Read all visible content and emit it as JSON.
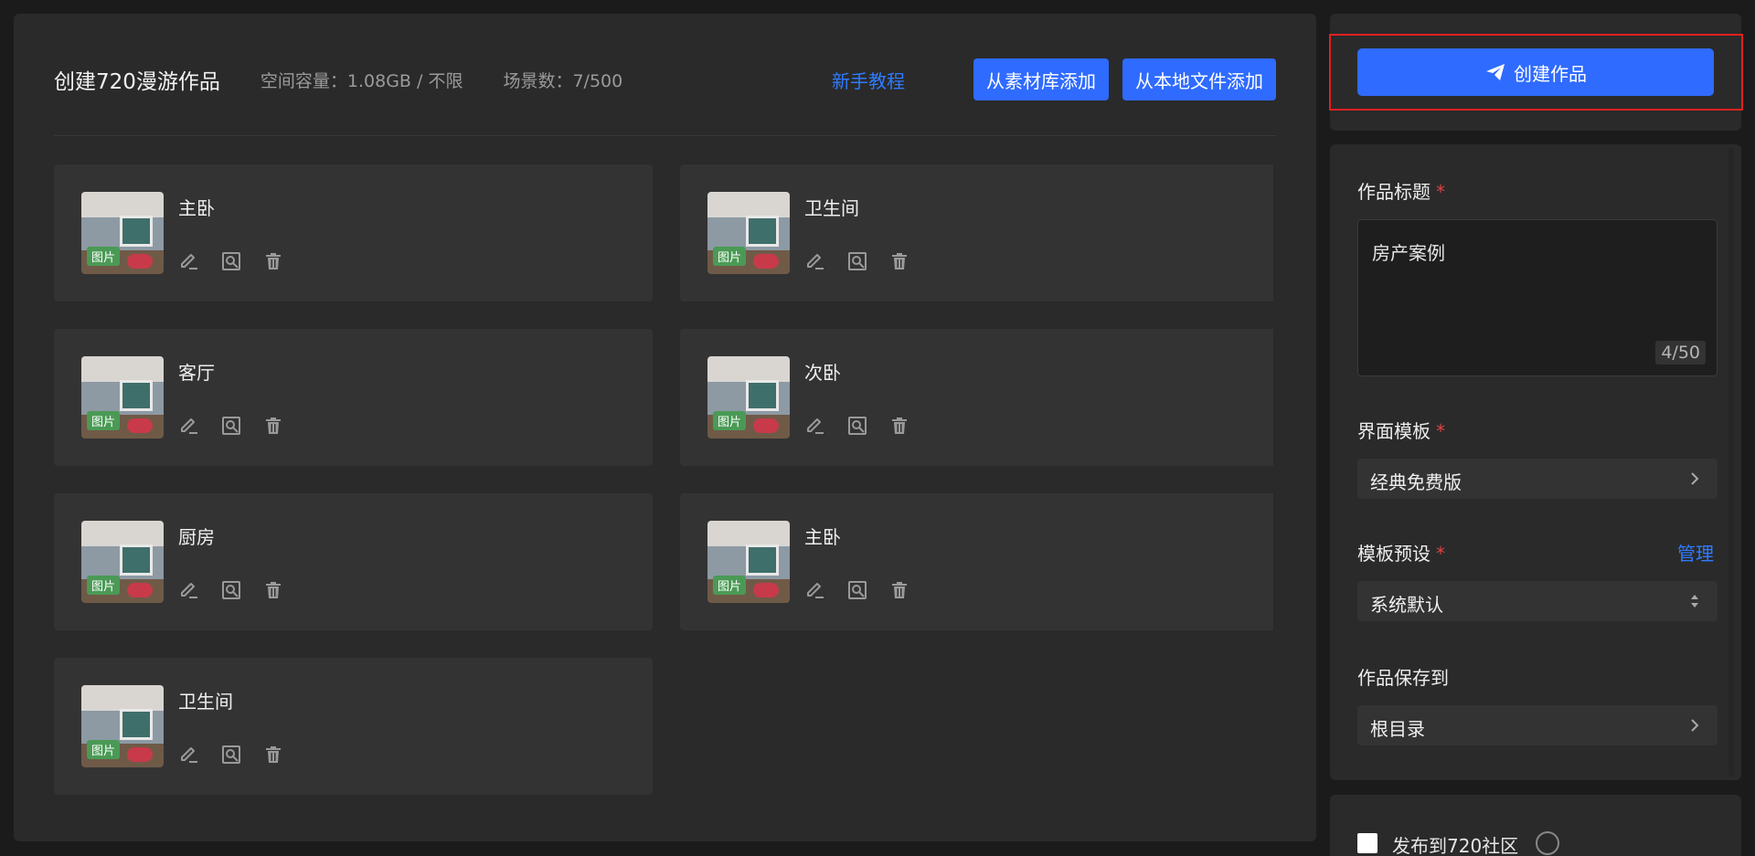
{
  "header": {
    "title": "创建720漫游作品",
    "storage": "空间容量：1.08GB / 不限",
    "scenes": "场景数：7/500",
    "tutorial": "新手教程",
    "add_from_library": "从素材库添加",
    "add_from_local": "从本地文件添加"
  },
  "scenes": [
    {
      "name": "主卧",
      "badge": "图片"
    },
    {
      "name": "卫生间",
      "badge": "图片"
    },
    {
      "name": "客厅",
      "badge": "图片"
    },
    {
      "name": "次卧",
      "badge": "图片"
    },
    {
      "name": "厨房",
      "badge": "图片"
    },
    {
      "name": "主卧",
      "badge": "图片"
    },
    {
      "name": "卫生间",
      "badge": "图片"
    }
  ],
  "side": {
    "create_button": "创建作品",
    "title_label": "作品标题",
    "title_value": "房产案例",
    "title_count": "4/50",
    "template_label": "界面模板",
    "template_value": "经典免费版",
    "preset_label": "模板预设",
    "preset_manage": "管理",
    "preset_value": "系统默认",
    "save_label": "作品保存到",
    "save_value": "根目录",
    "publish_label": "发布到720社区"
  },
  "colors": {
    "accent": "#2f6bff",
    "link": "#2f7bff",
    "required": "#e04040",
    "badge": "#4a9a55",
    "highlight": "#e02020"
  },
  "icons": {
    "edit": "pencil-icon",
    "preview": "magnify-icon",
    "delete": "trash-icon",
    "create": "paper-plane-icon",
    "chevron": "chevron-right-icon",
    "sort": "sort-icon"
  }
}
